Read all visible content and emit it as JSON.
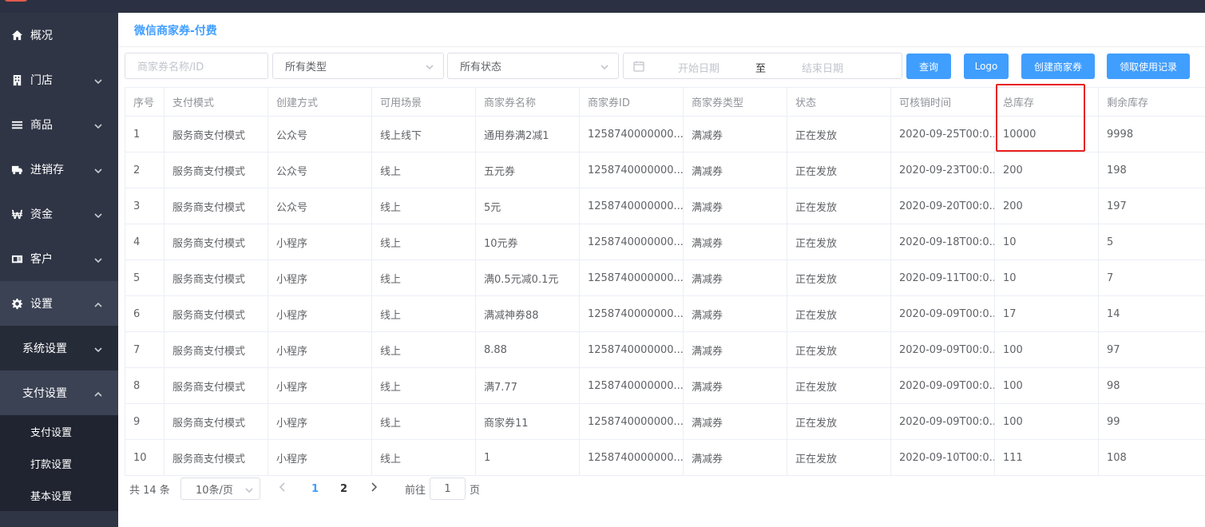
{
  "sidebar": {
    "items": [
      {
        "label": "概况",
        "icon": "home-icon"
      },
      {
        "label": "门店",
        "icon": "store-icon"
      },
      {
        "label": "商品",
        "icon": "list-icon"
      },
      {
        "label": "进销存",
        "icon": "truck-icon"
      },
      {
        "label": "资金",
        "icon": "won-icon"
      },
      {
        "label": "客户",
        "icon": "id-card-icon"
      },
      {
        "label": "设置",
        "icon": "gear-icon"
      }
    ],
    "sub_items": [
      {
        "label": "系统设置"
      },
      {
        "label": "支付设置"
      }
    ],
    "leaves": [
      {
        "label": "支付设置"
      },
      {
        "label": "打款设置"
      },
      {
        "label": "基本设置"
      }
    ]
  },
  "page": {
    "title": "微信商家券-付费"
  },
  "filters": {
    "name_placeholder": "商家券名称/ID",
    "type_value": "所有类型",
    "status_value": "所有状态",
    "start_placeholder": "开始日期",
    "range_sep": "至",
    "end_placeholder": "结束日期"
  },
  "buttons": {
    "query": "查询",
    "logo": "Logo",
    "create": "创建商家券",
    "records": "领取使用记录"
  },
  "table": {
    "headers": [
      "序号",
      "支付模式",
      "创建方式",
      "可用场景",
      "商家券名称",
      "商家券ID",
      "商家券类型",
      "状态",
      "可核销时间",
      "总库存",
      "剩余库存"
    ],
    "rows": [
      [
        "1",
        "服务商支付模式",
        "公众号",
        "线上线下",
        "通用券满2减1",
        "1258740000000...",
        "满减券",
        "正在发放",
        "2020-09-25T00:0...",
        "10000",
        "9998"
      ],
      [
        "2",
        "服务商支付模式",
        "公众号",
        "线上",
        "五元券",
        "1258740000000...",
        "满减券",
        "正在发放",
        "2020-09-23T00:0...",
        "200",
        "198"
      ],
      [
        "3",
        "服务商支付模式",
        "公众号",
        "线上",
        "5元",
        "1258740000000...",
        "满减券",
        "正在发放",
        "2020-09-20T00:0...",
        "200",
        "197"
      ],
      [
        "4",
        "服务商支付模式",
        "小程序",
        "线上",
        "10元券",
        "1258740000000...",
        "满减券",
        "正在发放",
        "2020-09-18T00:0...",
        "10",
        "5"
      ],
      [
        "5",
        "服务商支付模式",
        "小程序",
        "线上",
        "满0.5元减0.1元",
        "1258740000000...",
        "满减券",
        "正在发放",
        "2020-09-11T00:0...",
        "10",
        "7"
      ],
      [
        "6",
        "服务商支付模式",
        "小程序",
        "线上",
        "满减神券88",
        "1258740000000...",
        "满减券",
        "正在发放",
        "2020-09-09T00:0...",
        "17",
        "14"
      ],
      [
        "7",
        "服务商支付模式",
        "小程序",
        "线上",
        "8.88",
        "1258740000000...",
        "满减券",
        "正在发放",
        "2020-09-09T00:0...",
        "100",
        "97"
      ],
      [
        "8",
        "服务商支付模式",
        "小程序",
        "线上",
        "满7.77",
        "1258740000000...",
        "满减券",
        "正在发放",
        "2020-09-09T00:0...",
        "100",
        "98"
      ],
      [
        "9",
        "服务商支付模式",
        "小程序",
        "线上",
        "商家券11",
        "1258740000000...",
        "满减券",
        "正在发放",
        "2020-09-09T00:0...",
        "100",
        "99"
      ],
      [
        "10",
        "服务商支付模式",
        "小程序",
        "线上",
        "1",
        "1258740000000...",
        "满减券",
        "正在发放",
        "2020-09-10T00:0...",
        "111",
        "108"
      ]
    ]
  },
  "pagination": {
    "total": "共 14 条",
    "page_size": "10条/页",
    "page1": "1",
    "page2": "2",
    "goto_label": "前往",
    "goto_value": "1",
    "page_unit": "页"
  },
  "colors": {
    "accent": "#409eff",
    "sidebar_bg": "#2f3545",
    "highlight_box": "#e81e1e"
  }
}
